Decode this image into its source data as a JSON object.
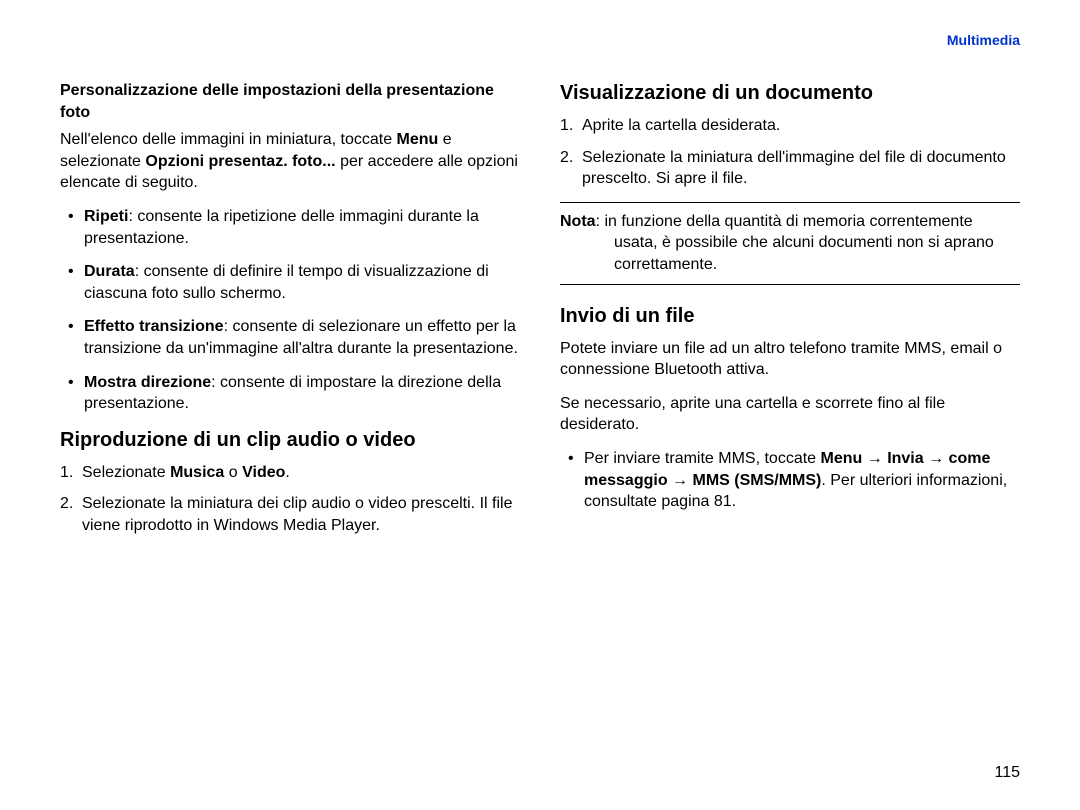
{
  "header": "Multimedia",
  "pageNumber": "115",
  "left": {
    "h3": "Personalizzazione delle impostazioni della presentazione foto",
    "intro_pre": "Nell'elenco delle immagini in miniatura, toccate ",
    "intro_b1": "Menu",
    "intro_mid": " e selezionate ",
    "intro_b2": "Opzioni presentaz. foto...",
    "intro_post": " per accedere alle opzioni elencate di seguito.",
    "bullets": [
      {
        "b": "Ripeti",
        "t": ": consente la ripetizione delle immagini durante la presentazione."
      },
      {
        "b": "Durata",
        "t": ": consente di definire il tempo di visualizzazione di ciascuna foto sullo schermo."
      },
      {
        "b": "Effetto transizione",
        "t": ": consente di selezionare un effetto per la transizione da un'immagine all'altra durante la presentazione."
      },
      {
        "b": "Mostra direzione",
        "t": ": consente di impostare la direzione della presentazione."
      }
    ],
    "h2": "Riproduzione di un clip audio o video",
    "ol": [
      {
        "pre": "Selezionate ",
        "b1": "Musica",
        "mid": " o ",
        "b2": "Video",
        "post": "."
      },
      {
        "plain": "Selezionate la miniatura dei clip audio o video prescelti. Il file viene riprodotto in Windows Media Player."
      }
    ]
  },
  "right": {
    "h2a": "Visualizzazione di un documento",
    "ol1": [
      "Aprite la cartella desiderata.",
      "Selezionate la miniatura dell'immagine del file di documento prescelto. Si apre il file."
    ],
    "note_label": "Nota",
    "note_text": ": in funzione della quantità di memoria correntemente usata, è possibile che alcuni documenti non si aprano correttamente.",
    "h2b": "Invio di un file",
    "p1": "Potete inviare un file ad un altro telefono tramite MMS, email o connessione Bluetooth attiva.",
    "p2": "Se necessario, aprite una cartella e scorrete fino al file desiderato.",
    "bul": {
      "pre": "Per inviare tramite MMS, toccate ",
      "b1": "Menu",
      "arrow1": " → ",
      "b2": "Invia",
      "arrow2": " → ",
      "b3": "come messaggio",
      "arrow3": " → ",
      "b4": "MMS (SMS/MMS)",
      "post": ". Per ulteriori informazioni, consultate pagina 81."
    }
  }
}
